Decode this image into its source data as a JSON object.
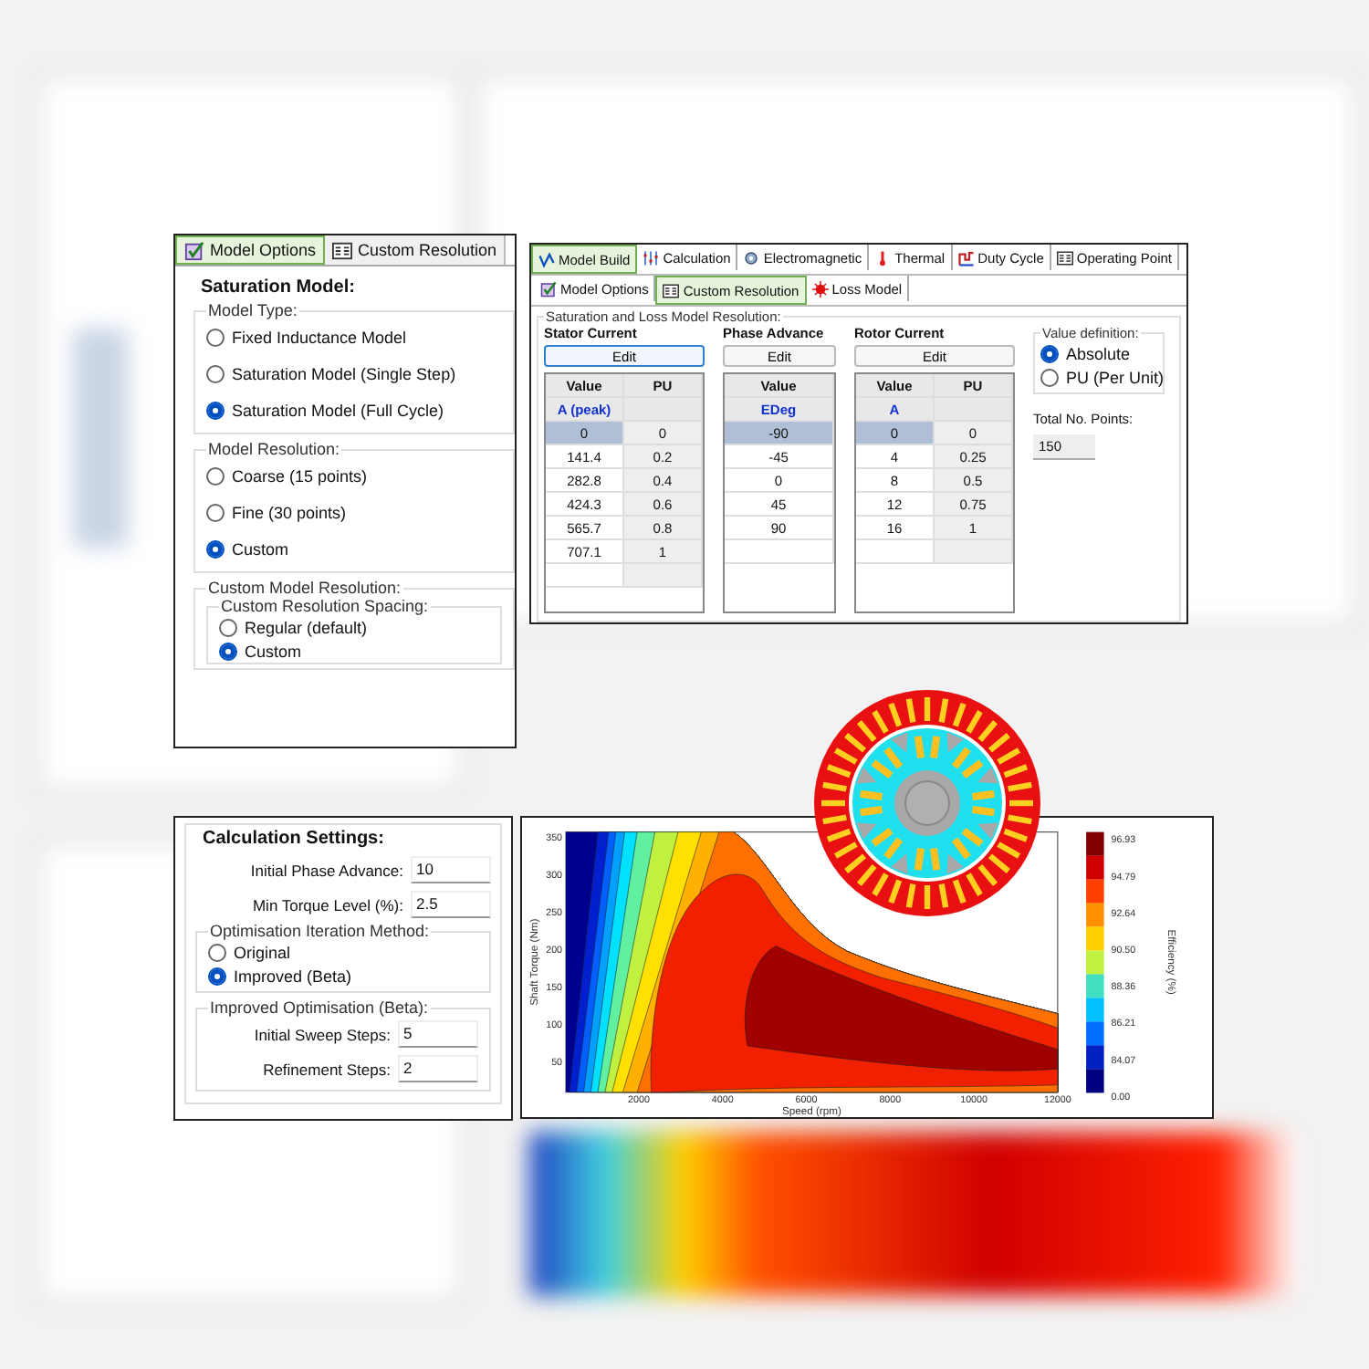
{
  "model_options_panel": {
    "tabs": [
      {
        "label": "Model Options",
        "selected": true
      },
      {
        "label": "Custom Resolution",
        "selected": false
      }
    ],
    "title": "Saturation Model:",
    "groups": [
      {
        "legend": "Model Type:",
        "options": [
          {
            "label": "Fixed Inductance Model",
            "selected": false
          },
          {
            "label": "Saturation Model (Single Step)",
            "selected": false
          },
          {
            "label": "Saturation Model (Full Cycle)",
            "selected": true
          }
        ]
      },
      {
        "legend": "Model Resolution:",
        "options": [
          {
            "label": "Coarse (15 points)",
            "selected": false
          },
          {
            "label": "Fine (30 points)",
            "selected": false
          },
          {
            "label": "Custom",
            "selected": true
          }
        ]
      },
      {
        "legend": "Custom Model Resolution:",
        "sublegend": "Custom Resolution Spacing:",
        "options": [
          {
            "label": "Regular (default)",
            "selected": false
          },
          {
            "label": "Custom",
            "selected": true
          }
        ]
      }
    ]
  },
  "resolution_panel": {
    "main_tabs": [
      {
        "label": "Model Build",
        "selected": true
      },
      {
        "label": "Calculation",
        "selected": false
      },
      {
        "label": "Electromagnetic",
        "selected": false
      },
      {
        "label": "Thermal",
        "selected": false
      },
      {
        "label": "Duty Cycle",
        "selected": false
      },
      {
        "label": "Operating Point",
        "selected": false
      }
    ],
    "sub_tabs": [
      {
        "label": "Model Options",
        "selected": false
      },
      {
        "label": "Custom Resolution",
        "selected": true
      },
      {
        "label": "Loss Model",
        "selected": false
      }
    ],
    "legend": "Saturation and Loss Model Resolution:",
    "tables": [
      {
        "title": "Stator Current",
        "button": "Edit",
        "focused": true,
        "columns": [
          {
            "header": "Value",
            "unit": "A (peak)"
          },
          {
            "header": "PU"
          }
        ],
        "rows": [
          {
            "cells": [
              "0",
              "0"
            ],
            "selected": true
          },
          {
            "cells": [
              "141.4",
              "0.2"
            ],
            "selected": false
          },
          {
            "cells": [
              "282.8",
              "0.4"
            ],
            "selected": false
          },
          {
            "cells": [
              "424.3",
              "0.6"
            ],
            "selected": false
          },
          {
            "cells": [
              "565.7",
              "0.8"
            ],
            "selected": false
          },
          {
            "cells": [
              "707.1",
              "1"
            ],
            "selected": false
          }
        ]
      },
      {
        "title": "Phase Advance",
        "button": "Edit",
        "focused": false,
        "columns": [
          {
            "header": "Value",
            "unit": "EDeg"
          }
        ],
        "rows": [
          {
            "cells": [
              "-90"
            ],
            "selected": true
          },
          {
            "cells": [
              "-45"
            ],
            "selected": false
          },
          {
            "cells": [
              "0"
            ],
            "selected": false
          },
          {
            "cells": [
              "45"
            ],
            "selected": false
          },
          {
            "cells": [
              "90"
            ],
            "selected": false
          }
        ]
      },
      {
        "title": "Rotor Current",
        "button": "Edit",
        "focused": false,
        "columns": [
          {
            "header": "Value",
            "unit": "A"
          },
          {
            "header": "PU"
          }
        ],
        "rows": [
          {
            "cells": [
              "0",
              "0"
            ],
            "selected": true
          },
          {
            "cells": [
              "4",
              "0.25"
            ],
            "selected": false
          },
          {
            "cells": [
              "8",
              "0.5"
            ],
            "selected": false
          },
          {
            "cells": [
              "12",
              "0.75"
            ],
            "selected": false
          },
          {
            "cells": [
              "16",
              "1"
            ],
            "selected": false
          }
        ]
      }
    ],
    "value_definition": {
      "legend": "Value definition:",
      "options": [
        {
          "label": "Absolute",
          "selected": true
        },
        {
          "label": "PU (Per Unit)",
          "selected": false
        }
      ]
    },
    "total_points": {
      "label": "Total No. Points:",
      "value": "150"
    }
  },
  "calculation_settings": {
    "title": "Calculation Settings:",
    "fields": [
      {
        "label": "Initial Phase Advance:",
        "value": "10"
      },
      {
        "label": "Min Torque Level (%):",
        "value": "2.5"
      }
    ],
    "method": {
      "legend": "Optimisation Iteration Method:",
      "options": [
        {
          "label": "Original",
          "selected": false
        },
        {
          "label": "Improved (Beta)",
          "selected": true
        }
      ]
    },
    "improved": {
      "legend": "Improved Optimisation (Beta):",
      "fields": [
        {
          "label": "Initial Sweep Steps:",
          "value": "5"
        },
        {
          "label": "Refinement Steps:",
          "value": "2"
        }
      ]
    }
  },
  "efficiency_map": {
    "xlabel": "Speed (rpm)",
    "ylabel": "Shaft Torque (Nm)",
    "xticks": [
      "2000",
      "4000",
      "6000",
      "8000",
      "10000",
      "12000"
    ],
    "yticks": [
      "350",
      "300",
      "250",
      "200",
      "150",
      "100",
      "50"
    ],
    "colorbar_title": "Efficiency (%)",
    "colorbar_labels": [
      "96.93",
      "94.79",
      "92.64",
      "90.50",
      "88.36",
      "86.21",
      "84.07",
      "0.00"
    ]
  }
}
